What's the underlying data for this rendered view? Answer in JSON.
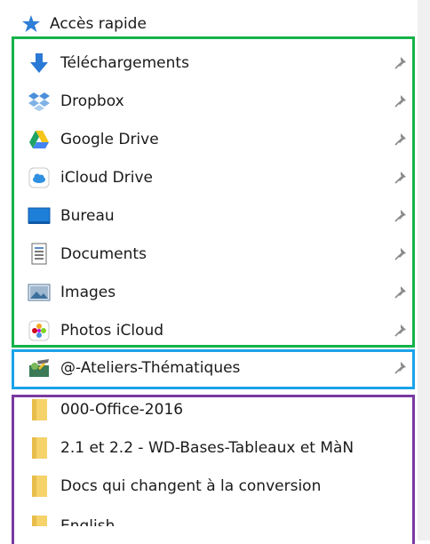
{
  "quick_access": {
    "title": "Accès rapide",
    "pinned": [
      {
        "label": "Téléchargements",
        "icon": "download-arrow-icon"
      },
      {
        "label": "Dropbox",
        "icon": "dropbox-icon"
      },
      {
        "label": "Google Drive",
        "icon": "google-drive-icon"
      },
      {
        "label": "iCloud Drive",
        "icon": "icloud-drive-icon"
      },
      {
        "label": "Bureau",
        "icon": "desktop-icon"
      },
      {
        "label": "Documents",
        "icon": "documents-icon"
      },
      {
        "label": "Images",
        "icon": "pictures-icon"
      },
      {
        "label": "Photos iCloud",
        "icon": "photos-icloud-icon"
      }
    ],
    "workshop": {
      "label": "@-Ateliers-Thématiques",
      "icon": "workshop-folder-icon"
    },
    "folders": [
      {
        "label": "000-Office-2016",
        "icon": "folder-icon"
      },
      {
        "label": "2.1 et 2.2 - WD-Bases-Tableaux et MàN",
        "icon": "folder-icon"
      },
      {
        "label": "Docs qui changent à la conversion",
        "icon": "folder-icon"
      },
      {
        "label": "English",
        "icon": "folder-icon"
      }
    ]
  },
  "colors": {
    "green_box": "#13b24a",
    "blue_box": "#1aa3e8",
    "purple_box": "#7a3ba0"
  }
}
